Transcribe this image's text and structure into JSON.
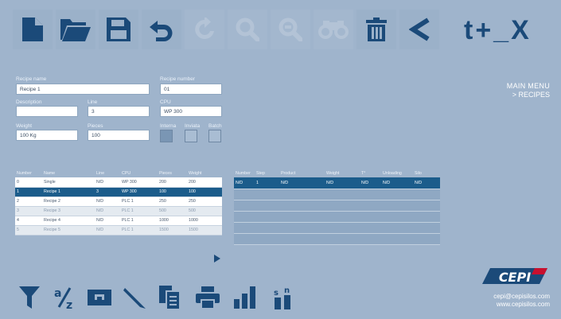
{
  "title_tools": "t+_X",
  "menu": {
    "main": "MAIN MENU",
    "sub": "> RECIPES"
  },
  "form": {
    "recipe_name_label": "Recipe name",
    "recipe_name": "Recipe 1",
    "recipe_number_label": "Recipe number",
    "recipe_number": "01",
    "description_label": "Description",
    "description": "",
    "line_label": "Line",
    "line": "3",
    "cpu_label": "CPU",
    "cpu": "WP 300",
    "weight_label": "Weight",
    "weight": "100 Kg",
    "pieces_label": "Pieces",
    "pieces": "100",
    "interna_label": "Interna",
    "inviata_label": "Inviata",
    "batch_label": "Batch",
    "interna_checked": true,
    "inviata_checked": false,
    "batch_checked": false
  },
  "recipes_table": {
    "headers": [
      "Number",
      "Name",
      "Line",
      "CPU",
      "Pieces",
      "Weight"
    ],
    "rows": [
      [
        "0",
        "Single",
        "N/D",
        "WP 300",
        "200",
        "200"
      ],
      [
        "1",
        "Recipe 1",
        "3",
        "WP 300",
        "100",
        "100"
      ],
      [
        "2",
        "Recipe 2",
        "N/D",
        "PLC 1",
        "250",
        "250"
      ],
      [
        "3",
        "Recipe 3",
        "N/D",
        "PLC 1",
        "500",
        "500"
      ],
      [
        "4",
        "Recipe 4",
        "N/D",
        "PLC 1",
        "1000",
        "1000"
      ],
      [
        "5",
        "Recipe 5",
        "N/D",
        "PLC 1",
        "1500",
        "1500"
      ]
    ],
    "selected_index": 1
  },
  "steps_table": {
    "headers": [
      "Number",
      "Step",
      "Product",
      "Weight",
      "T°",
      "Unloading",
      "Silo"
    ],
    "rows": [
      [
        "N/D",
        "1",
        "N/D",
        "N/D",
        "N/D",
        "N/D",
        "N/D"
      ],
      [
        "",
        "",
        "",
        "",
        "",
        "",
        ""
      ],
      [
        "",
        "",
        "",
        "",
        "",
        "",
        ""
      ],
      [
        "",
        "",
        "",
        "",
        "",
        "",
        ""
      ],
      [
        "",
        "",
        "",
        "",
        "",
        "",
        ""
      ],
      [
        "",
        "",
        "",
        "",
        "",
        "",
        ""
      ]
    ]
  },
  "contact": {
    "email": "cepi@cepisilos.com",
    "web": "www.cepisilos.com"
  },
  "logo_text": "CEPI",
  "sort_icon_glyphs": {
    "top": "a",
    "bottom": "z"
  },
  "stat_icon_glyphs": {
    "s": "s",
    "n": "n"
  },
  "colors": {
    "background": "#9fb4cc",
    "icon_dark": "#1b4a79",
    "selected_row": "#1b5c8b",
    "logo_red": "#c8102e"
  }
}
